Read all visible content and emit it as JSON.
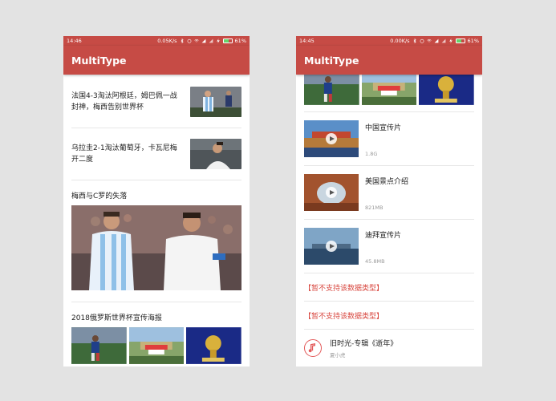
{
  "left_phone": {
    "status": {
      "time": "14:46",
      "speed": "0.05K/s",
      "battery": "61%",
      "battery_level": 0.61
    },
    "appbar_title": "MultiType",
    "news": [
      {
        "title": "法国4-3淘汰阿根廷，姆巴佩一战封神，梅西告别世界杯"
      },
      {
        "title": "乌拉圭2-1淘汰葡萄牙，卡瓦尼梅开二度"
      }
    ],
    "big_section_title": "梅西与C罗的失落",
    "gallery_section_title": "2018俄罗斯世界杯宣传海报"
  },
  "right_phone": {
    "status": {
      "time": "14:45",
      "speed": "0.00K/s",
      "battery": "61%",
      "battery_level": 0.61
    },
    "appbar_title": "MultiType",
    "videos": [
      {
        "title": "中国宣传片",
        "size": "1.8G"
      },
      {
        "title": "美国景点介绍",
        "size": "821MB"
      },
      {
        "title": "迪拜宣传片",
        "size": "45.8MB"
      }
    ],
    "unsupported": [
      {
        "label": "【暂不支持该数据类型】"
      },
      {
        "label": "【暂不支持该数据类型】"
      }
    ],
    "music": {
      "title": "旧时光-专辑《逝年》",
      "artist": "夏小虎"
    }
  },
  "colors": {
    "primary": "#c64b45",
    "accent_text": "#d8463e"
  }
}
